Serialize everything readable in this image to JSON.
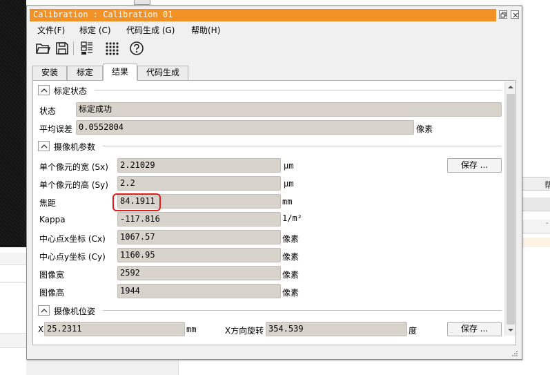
{
  "window": {
    "title": "Calibration : Calibration 01"
  },
  "menu": [
    {
      "label": "文件(F)"
    },
    {
      "label": "标定 (C)"
    },
    {
      "label": "代码生成 (G)"
    },
    {
      "label": "帮助(H)"
    }
  ],
  "toolbar": {
    "icons": [
      "folder-open-icon",
      "save-icon",
      "image-list-icon",
      "calibration-grid-icon",
      "help-icon"
    ]
  },
  "tabs": [
    {
      "label": "安装",
      "active": false
    },
    {
      "label": "标定",
      "active": false
    },
    {
      "label": "结果",
      "active": true
    },
    {
      "label": "代码生成",
      "active": false
    }
  ],
  "sections": {
    "status": {
      "title": "标定状态",
      "state_label": "状态",
      "state_value": "标定成功",
      "error_label": "平均误差",
      "error_value": "0.0552804",
      "error_unit": "像素"
    },
    "camera": {
      "title": "摄像机参数",
      "save_button": "保存 ...",
      "rows": [
        {
          "label": "单个像元的宽 (Sx)",
          "value": "2.21029",
          "unit": "μm"
        },
        {
          "label": "单个像元的高 (Sy)",
          "value": "2.2",
          "unit": "μm"
        },
        {
          "label": "焦距",
          "value": "84.1911",
          "unit": "mm"
        },
        {
          "label": "Kappa",
          "value": "-117.816",
          "unit": "1/m²"
        },
        {
          "label": "中心点x坐标 (Cx)",
          "value": "1067.57",
          "unit": "像素"
        },
        {
          "label": "中心点y坐标 (Cy)",
          "value": "1160.95",
          "unit": "像素"
        },
        {
          "label": "图像宽",
          "value": "2592",
          "unit": "像素"
        },
        {
          "label": "图像高",
          "value": "1944",
          "unit": "像素"
        }
      ]
    },
    "pose": {
      "title": "摄像机位姿",
      "x_label": "X",
      "x_value": "25.2311",
      "x_unit": "mm",
      "rot_label": "X方向旋转",
      "rot_value": "354.539",
      "rot_unit": "度",
      "save_button": "保存 ..."
    }
  },
  "background": {
    "right_tab_char": "帮",
    "right_row_char": "-"
  },
  "colors": {
    "titlebar": "#f29226",
    "field_bg": "#d8d4cc",
    "highlight": "#e31b1b"
  }
}
